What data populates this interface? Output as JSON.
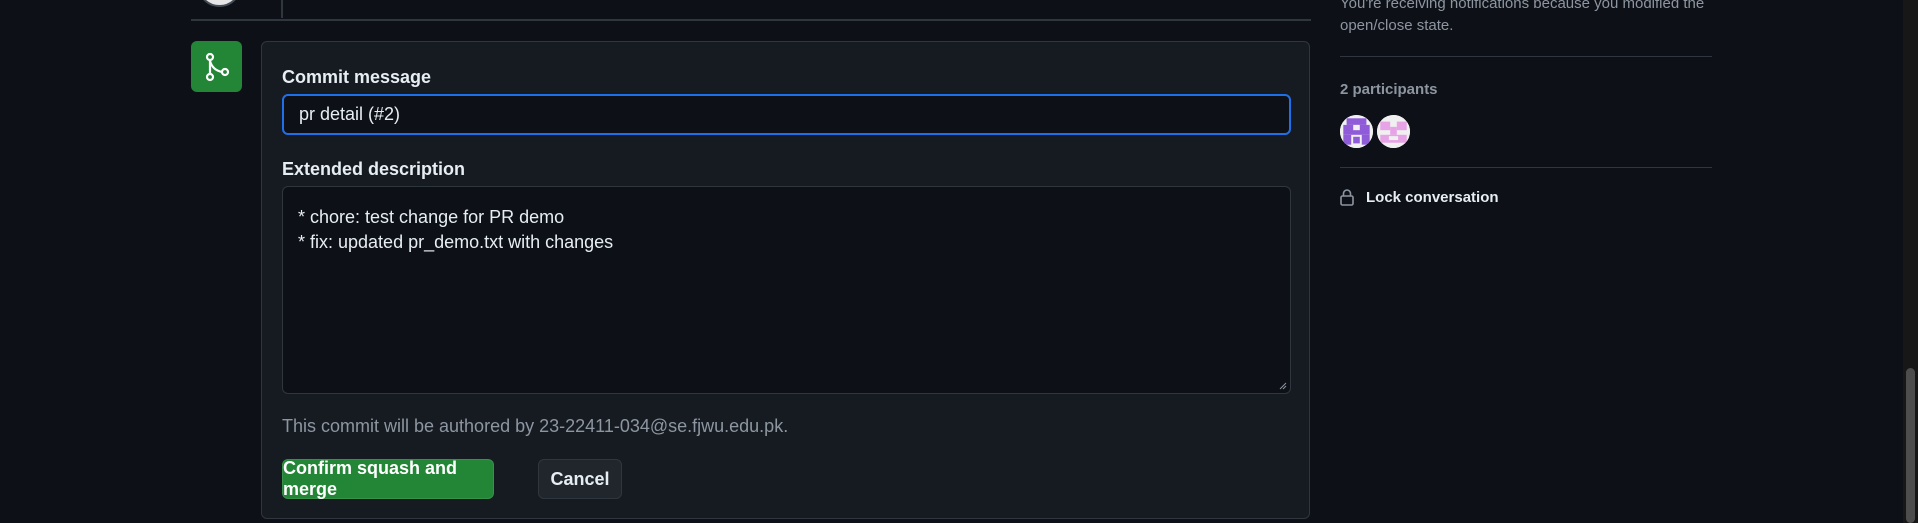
{
  "merge_form": {
    "commit_message_label": "Commit message",
    "commit_message_value": "pr detail (#2)",
    "extended_description_label": "Extended description",
    "extended_description_lines": [
      "* chore: test change for PR demo",
      "",
      "* fix: updated pr_demo.txt with changes"
    ],
    "author_note": "This commit will be authored by 23-22411-034@se.fjwu.edu.pk.",
    "confirm_label": "Confirm squash and merge",
    "cancel_label": "Cancel",
    "merge_icon": "git-merge-icon"
  },
  "sidebar": {
    "notification_text": "You're receiving notifications because you modified the open/close state.",
    "participants_title": "2 participants",
    "participants": [
      {
        "avatar": "purple-identicon",
        "color": "#8f5bd9"
      },
      {
        "avatar": "pink-identicon",
        "color": "#e6a3e6"
      }
    ],
    "lock_label": "Lock conversation",
    "lock_icon": "lock-icon"
  },
  "colors": {
    "background": "#0d1117",
    "merge_green": "#238636",
    "focus_blue": "#1f6feb"
  }
}
